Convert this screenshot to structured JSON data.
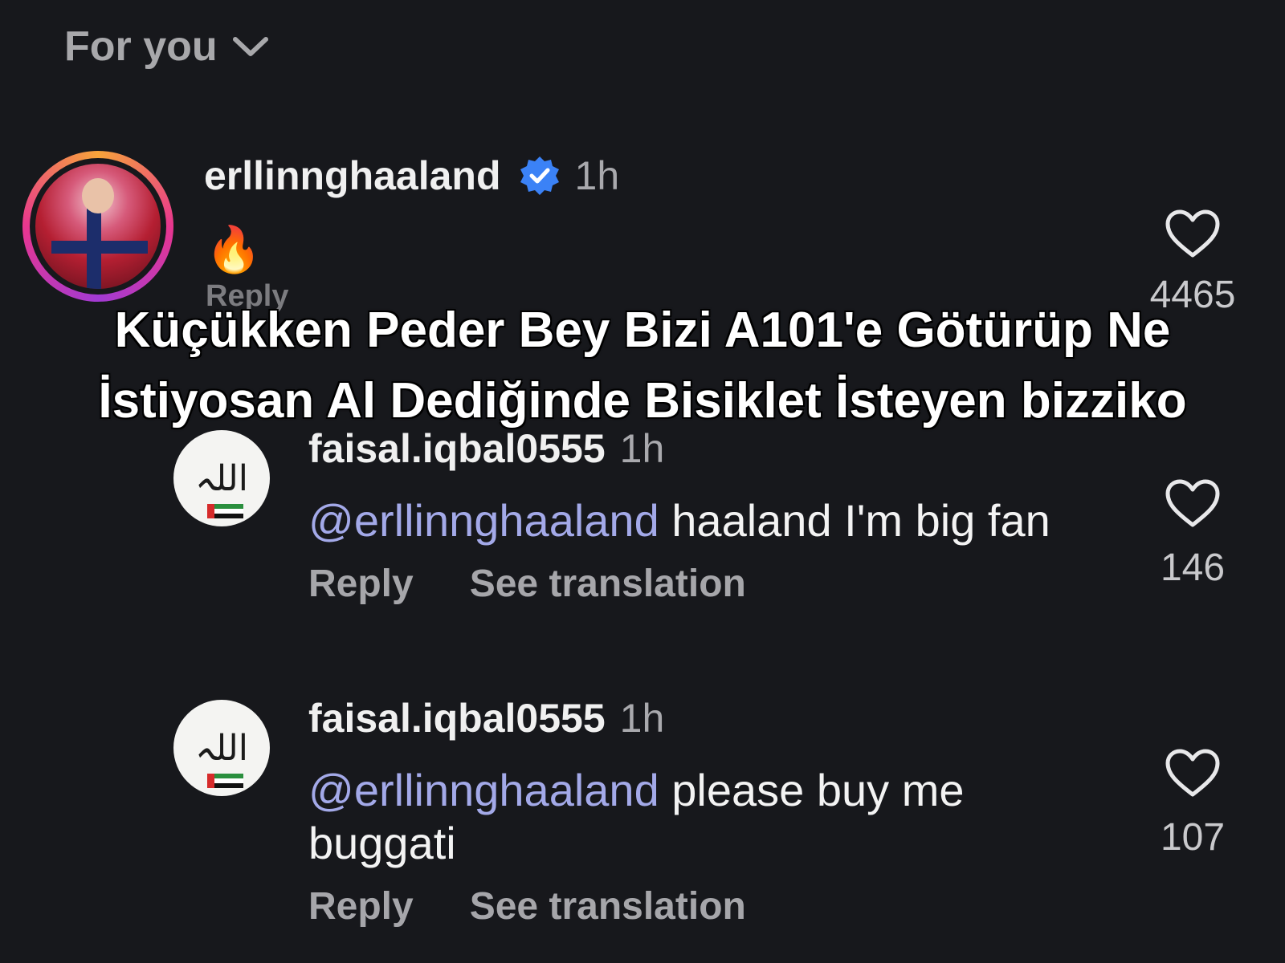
{
  "header": {
    "title": "For you",
    "dropdown_icon": "chevron-down-icon"
  },
  "post": {
    "username": "erllinnghaaland",
    "time": "1h",
    "verified": true,
    "content": "🔥",
    "reply_label": "Reply",
    "like_count": "4465"
  },
  "overlay_caption": {
    "line1": "Küçükken Peder Bey Bizi A101'e Götürüp Ne",
    "line2": "İstiyosan Al Dediğinde Bisiklet İsteyen bizziko"
  },
  "comments": [
    {
      "username": "faisal.iqbal0555",
      "time": "1h",
      "mention": "@erllinnghaaland",
      "text": " haaland I'm big fan",
      "reply_label": "Reply",
      "translate_label": "See translation",
      "like_count": "146"
    },
    {
      "username": "faisal.iqbal0555",
      "time": "1h",
      "mention": "@erllinnghaaland",
      "text": " please buy me buggati",
      "reply_label": "Reply",
      "translate_label": "See translation",
      "like_count": "107"
    }
  ],
  "colors": {
    "background": "#17181c",
    "mention": "#a3a9e8",
    "verified": "#3b82f6"
  }
}
